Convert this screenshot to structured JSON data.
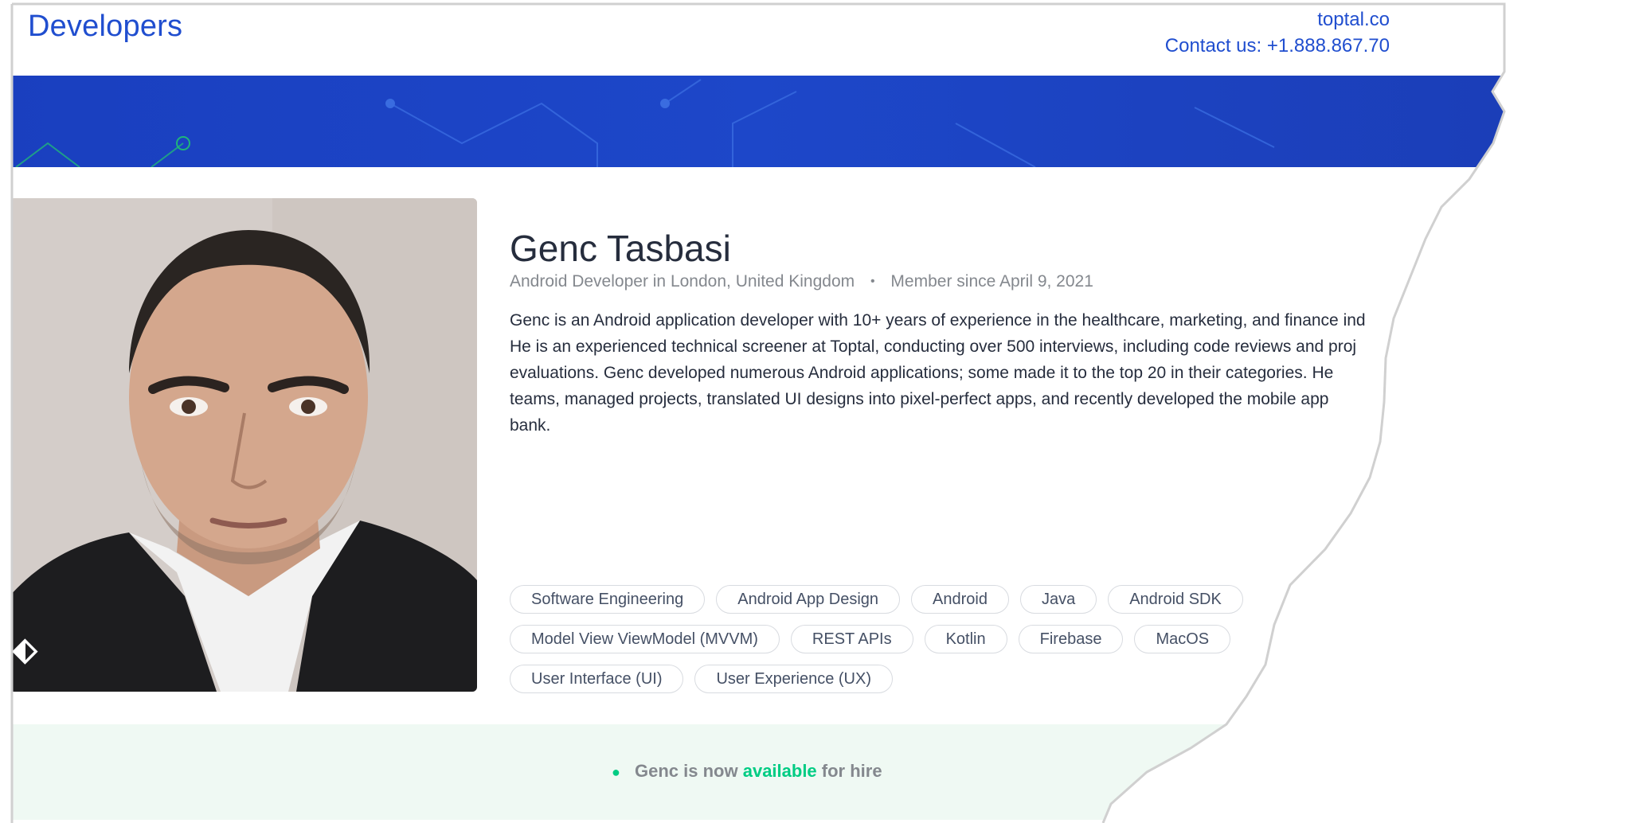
{
  "header": {
    "brand": "Developers",
    "site": "toptal.co",
    "contact": "Contact us: +1.888.867.70"
  },
  "profile": {
    "photo_alt": "portrait",
    "name": "Genc Tasbasi",
    "role_location": "Android Developer in London, United Kingdom",
    "member_since": "Member since April 9, 2021",
    "bio": [
      "Genc is an Android application developer with 10+ years of experience in the healthcare, marketing, and finance ind",
      "He is an experienced technical screener at Toptal, conducting over 500 interviews, including code reviews and proj",
      "evaluations. Genc developed numerous Android applications; some made it to the top 20 in their categories. He",
      "teams, managed projects, translated UI designs into pixel-perfect apps, and recently developed the mobile app",
      "bank."
    ],
    "skills": [
      "Software Engineering",
      "Android App Design",
      "Android",
      "Java",
      "Android SDK",
      "Model View ViewModel (MVVM)",
      "REST APIs",
      "Kotlin",
      "Firebase",
      "MacOS",
      "User Interface (UI)",
      "User Experience (UX)"
    ]
  },
  "availability": {
    "prefix": "Genc is now",
    "highlight": "available",
    "suffix": "for hire"
  },
  "colors": {
    "brand_blue": "#204ecf",
    "available_green": "#00cc83",
    "text_dark": "#262d3d",
    "text_muted": "#84888e"
  },
  "icons": {
    "photo_badge": "toptal-logo-icon"
  }
}
